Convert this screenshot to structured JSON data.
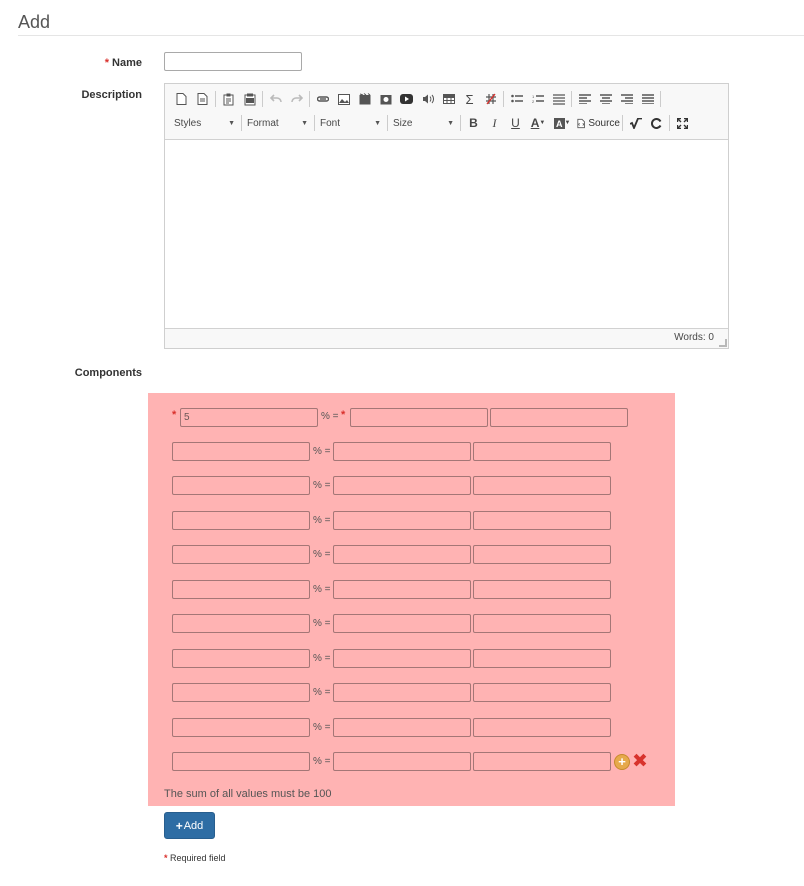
{
  "page": {
    "title": "Add"
  },
  "form": {
    "name_label": "Name",
    "name_value": "",
    "description_label": "Description",
    "components_label": "Components",
    "required_star": "*"
  },
  "editor": {
    "styles_label": "Styles",
    "format_label": "Format",
    "font_label": "Font",
    "size_label": "Size",
    "source_label": "Source",
    "bold_glyph": "B",
    "italic_glyph": "I",
    "underline_glyph": "U",
    "text_color_glyph": "A",
    "words_count": "Words: 0",
    "body_text": ""
  },
  "components": {
    "rows": [
      {
        "value": "5",
        "name": "",
        "extra": "",
        "required": true
      },
      {
        "value": "",
        "name": "",
        "extra": ""
      },
      {
        "value": "",
        "name": "",
        "extra": ""
      },
      {
        "value": "",
        "name": "",
        "extra": ""
      },
      {
        "value": "",
        "name": "",
        "extra": ""
      },
      {
        "value": "",
        "name": "",
        "extra": ""
      },
      {
        "value": "",
        "name": "",
        "extra": ""
      },
      {
        "value": "",
        "name": "",
        "extra": ""
      },
      {
        "value": "",
        "name": "",
        "extra": ""
      },
      {
        "value": "",
        "name": "",
        "extra": ""
      },
      {
        "value": "",
        "name": "",
        "extra": ""
      }
    ],
    "pct_label": "% =",
    "hint": "The sum of all values must be 100",
    "background_color": "#ffb3b3"
  },
  "actions": {
    "add_label": "Add",
    "add_icon": "+",
    "add_row_icon": "+",
    "remove_row_icon": "✖"
  },
  "footer": {
    "required_star": "*",
    "required_text": "Required field"
  },
  "colors": {
    "primary": "#2e6da4",
    "required": "#d9302c",
    "error_bg": "#ffb3b3"
  }
}
